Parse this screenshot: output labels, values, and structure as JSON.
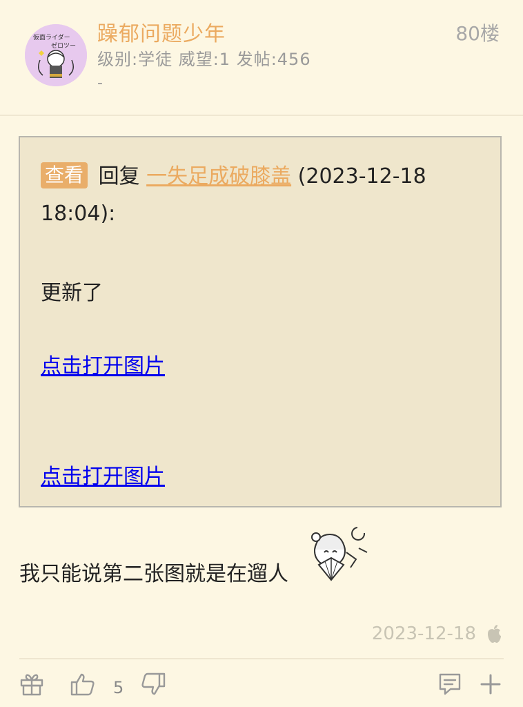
{
  "post": {
    "username": "躁郁问题少年",
    "meta": "级别:学徒 威望:1 发帖:456",
    "signature": "-",
    "floor": "80楼"
  },
  "quote": {
    "badge": "查看",
    "reply_word": "回复",
    "author": "一失足成破膝盖",
    "datetime": "(2023-12-18 18:04):",
    "body": "更新了",
    "image_links": [
      "点击打开图片",
      "点击打开图片"
    ]
  },
  "reply": {
    "text": "我只能说第二张图就是在遛人"
  },
  "footer": {
    "date": "2023-12-18",
    "like_count": "5"
  },
  "colors": {
    "background": "#FDF7E3",
    "accent_orange": "#EBAA60",
    "quote_bg": "#EFE6CC",
    "link_blue": "#0000EE"
  },
  "icons": [
    "avatar-image",
    "sticker-image",
    "apple-icon",
    "gift-icon",
    "thumbs-up-icon",
    "thumbs-down-icon",
    "comment-icon",
    "plus-icon"
  ]
}
